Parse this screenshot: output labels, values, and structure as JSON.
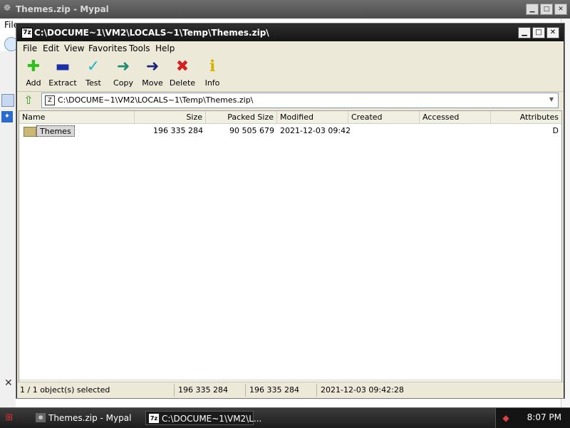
{
  "background_window": {
    "title": "Themes.zip - Mypal",
    "menu_partial": "File"
  },
  "window": {
    "title": "C:\\DOCUME~1\\VM2\\LOCALS~1\\Temp\\Themes.zip\\",
    "controls": {
      "minimize": "▁",
      "maximize": "□",
      "close": "✕"
    }
  },
  "menu": [
    "File",
    "Edit",
    "View",
    "Favorites",
    "Tools",
    "Help"
  ],
  "toolbar": [
    {
      "label": "Add",
      "icon": "plus-icon",
      "color": "#2fbf1f"
    },
    {
      "label": "Extract",
      "icon": "minus-icon",
      "color": "#1a2fa8"
    },
    {
      "label": "Test",
      "icon": "check-icon",
      "color": "#1fb5c8"
    },
    {
      "label": "Copy",
      "icon": "copy-arrow-icon",
      "color": "#1e8a73"
    },
    {
      "label": "Move",
      "icon": "move-arrow-icon",
      "color": "#1c237e"
    },
    {
      "label": "Delete",
      "icon": "delete-x-icon",
      "color": "#d61f1f"
    },
    {
      "label": "Info",
      "icon": "info-icon",
      "color": "#d4b400"
    }
  ],
  "address": {
    "path": "C:\\DOCUME~1\\VM2\\LOCALS~1\\Temp\\Themes.zip\\"
  },
  "columns": [
    "Name",
    "Size",
    "Packed Size",
    "Modified",
    "Created",
    "Accessed",
    "Attributes"
  ],
  "rows": [
    {
      "name": "Themes",
      "size": "196 335 284",
      "packed": "90 505 679",
      "modified": "2021-12-03 09:42",
      "created": "",
      "accessed": "",
      "attributes": "D"
    }
  ],
  "status": {
    "selection": "1 / 1 object(s) selected",
    "size": "196 335 284",
    "total": "196 335 284",
    "modified": "2021-12-03 09:42:28"
  },
  "taskbar": {
    "items": [
      "Themes.zip - Mypal",
      "C:\\DOCUME~1\\VM2\\L..."
    ],
    "clock": "8:07 PM"
  }
}
